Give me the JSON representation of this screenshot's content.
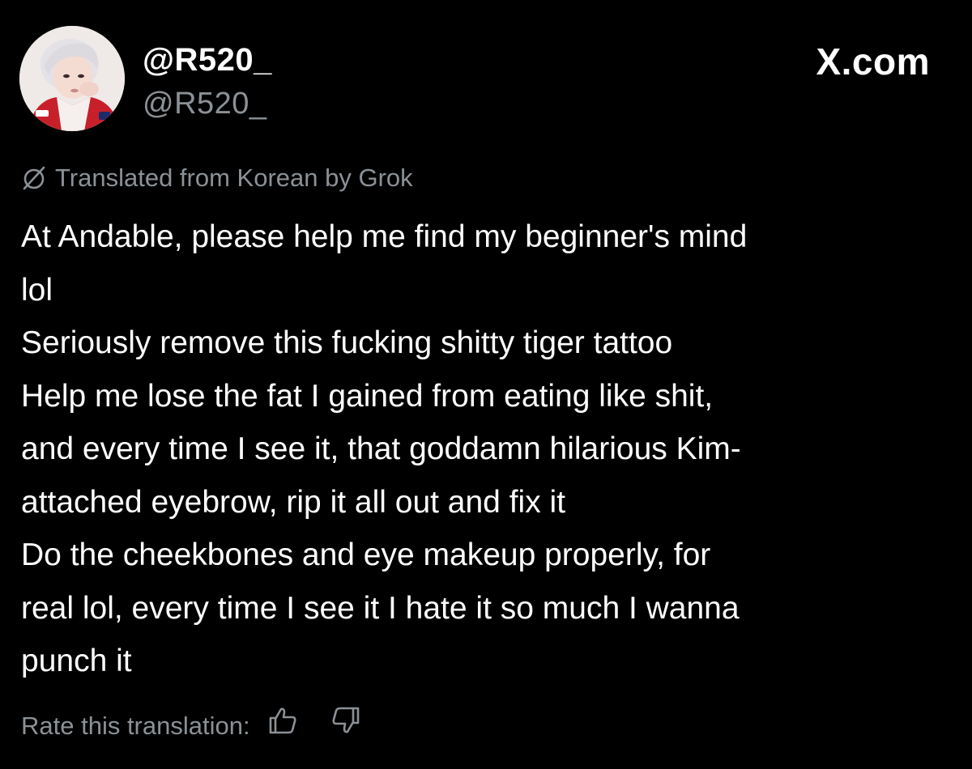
{
  "header": {
    "display_name": "@R520_",
    "handle": "@R520_",
    "site": "X.com"
  },
  "translation": {
    "note": "Translated from Korean by Grok",
    "icon": "translate-slash-icon"
  },
  "tweet": {
    "lines": [
      "At Andable, please help me find my beginner's mind",
      "lol",
      "Seriously remove this fucking shitty tiger tattoo",
      "Help me lose the fat I gained from eating like shit,",
      "and every time I see it, that goddamn hilarious Kim-",
      "attached eyebrow, rip it all out and fix it",
      "Do the cheekbones and eye makeup properly, for",
      "real lol, every time I see it I hate it so much I wanna",
      "punch it"
    ]
  },
  "rating": {
    "label": "Rate this translation:",
    "thumbs_up_icon": "thumbs-up-icon",
    "thumbs_down_icon": "thumbs-down-icon"
  },
  "colors": {
    "background": "#000000",
    "primary_text": "#ffffff",
    "secondary_text": "#8b9196"
  }
}
